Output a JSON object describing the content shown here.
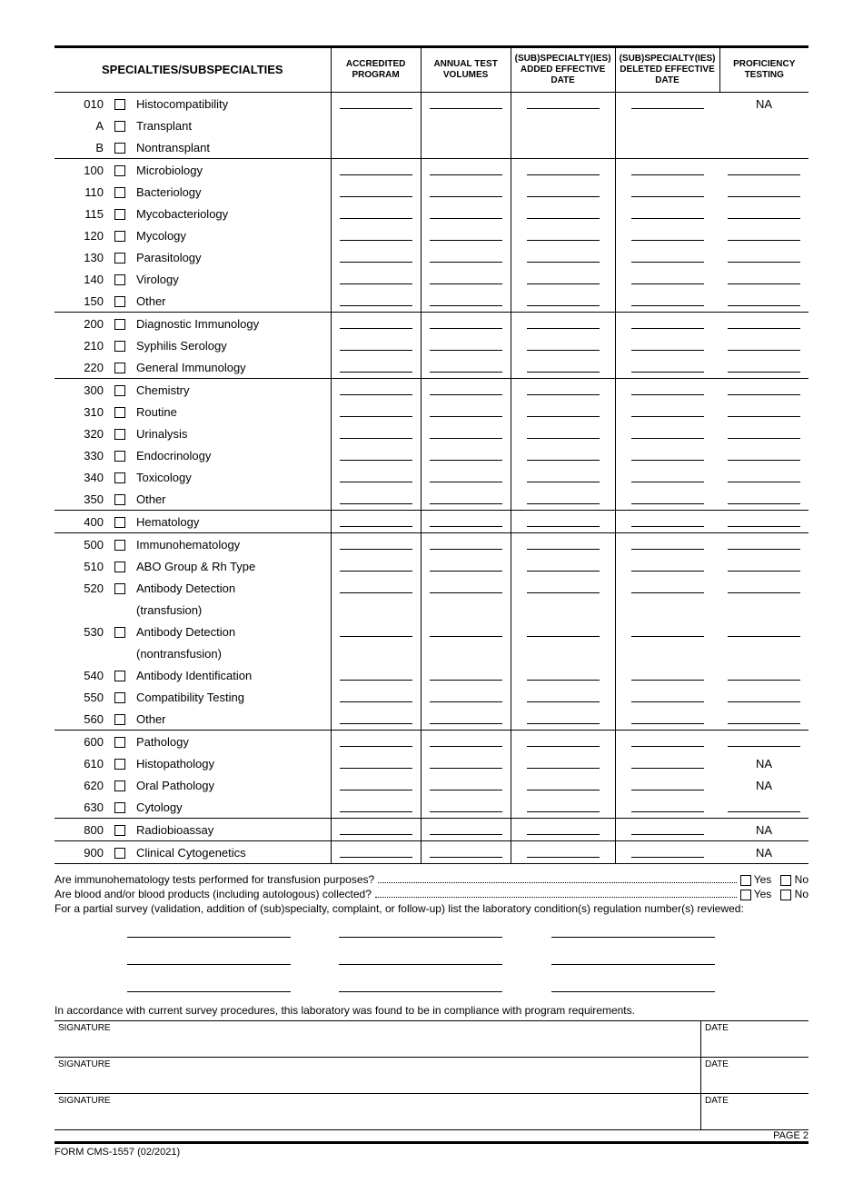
{
  "headers": {
    "col0": "SPECIALTIES/SUBSPECIALTIES",
    "col1": "ACCREDITED PROGRAM",
    "col2": "ANNUAL TEST VOLUMES",
    "col3": "(SUB)SPECIALTY(IES) ADDED EFFECTIVE DATE",
    "col4": "(SUB)SPECIALTY(IES) DELETED EFFECTIVE DATE",
    "col5": "PROFICIENCY TESTING"
  },
  "na": "NA",
  "rows": [
    {
      "code": "010",
      "label": "Histocompatibility",
      "sub": false,
      "b1": true,
      "b2": true,
      "b3": true,
      "b4": true,
      "prof": "NA",
      "sep": false
    },
    {
      "code": "A",
      "label": "Transplant",
      "sub": true,
      "b1": false,
      "b2": false,
      "b3": false,
      "b4": false,
      "prof": "",
      "sep": false
    },
    {
      "code": "B",
      "label": "Nontransplant",
      "sub": true,
      "b1": false,
      "b2": false,
      "b3": false,
      "b4": false,
      "prof": "",
      "sep": true
    },
    {
      "code": "100",
      "label": "Microbiology",
      "sub": false,
      "b1": true,
      "b2": true,
      "b3": true,
      "b4": true,
      "prof": "_",
      "sep": false
    },
    {
      "code": "110",
      "label": "Bacteriology",
      "sub": true,
      "b1": true,
      "b2": true,
      "b3": true,
      "b4": true,
      "prof": "_",
      "sep": false
    },
    {
      "code": "115",
      "label": "Mycobacteriology",
      "sub": true,
      "b1": true,
      "b2": true,
      "b3": true,
      "b4": true,
      "prof": "_",
      "sep": false
    },
    {
      "code": "120",
      "label": "Mycology",
      "sub": true,
      "b1": true,
      "b2": true,
      "b3": true,
      "b4": true,
      "prof": "_",
      "sep": false
    },
    {
      "code": "130",
      "label": "Parasitology",
      "sub": true,
      "b1": true,
      "b2": true,
      "b3": true,
      "b4": true,
      "prof": "_",
      "sep": false
    },
    {
      "code": "140",
      "label": "Virology",
      "sub": true,
      "b1": true,
      "b2": true,
      "b3": true,
      "b4": true,
      "prof": "_",
      "sep": false
    },
    {
      "code": "150",
      "label": "Other",
      "sub": true,
      "b1": true,
      "b2": true,
      "b3": true,
      "b4": true,
      "prof": "_",
      "sep": true
    },
    {
      "code": "200",
      "label": "Diagnostic Immunology",
      "sub": false,
      "b1": true,
      "b2": true,
      "b3": true,
      "b4": true,
      "prof": "_",
      "sep": false
    },
    {
      "code": "210",
      "label": "Syphilis Serology",
      "sub": true,
      "b1": true,
      "b2": true,
      "b3": true,
      "b4": true,
      "prof": "_",
      "sep": false
    },
    {
      "code": "220",
      "label": "General Immunology",
      "sub": true,
      "b1": true,
      "b2": true,
      "b3": true,
      "b4": true,
      "prof": "_",
      "sep": true
    },
    {
      "code": "300",
      "label": "Chemistry",
      "sub": false,
      "b1": true,
      "b2": true,
      "b3": true,
      "b4": true,
      "prof": "_",
      "sep": false
    },
    {
      "code": "310",
      "label": "Routine",
      "sub": true,
      "b1": true,
      "b2": true,
      "b3": true,
      "b4": true,
      "prof": "_",
      "sep": false
    },
    {
      "code": "320",
      "label": "Urinalysis",
      "sub": true,
      "b1": true,
      "b2": true,
      "b3": true,
      "b4": true,
      "prof": "_",
      "sep": false
    },
    {
      "code": "330",
      "label": "Endocrinology",
      "sub": true,
      "b1": true,
      "b2": true,
      "b3": true,
      "b4": true,
      "prof": "_",
      "sep": false
    },
    {
      "code": "340",
      "label": "Toxicology",
      "sub": true,
      "b1": true,
      "b2": true,
      "b3": true,
      "b4": true,
      "prof": "_",
      "sep": false
    },
    {
      "code": "350",
      "label": "Other",
      "sub": true,
      "b1": true,
      "b2": true,
      "b3": true,
      "b4": true,
      "prof": "_",
      "sep": true
    },
    {
      "code": "400",
      "label": "Hematology",
      "sub": false,
      "b1": true,
      "b2": true,
      "b3": true,
      "b4": true,
      "prof": "_",
      "sep": true
    },
    {
      "code": "500",
      "label": "Immunohematology",
      "sub": false,
      "b1": true,
      "b2": true,
      "b3": true,
      "b4": true,
      "prof": "_",
      "sep": false
    },
    {
      "code": "510",
      "label": "ABO Group & Rh Type",
      "sub": true,
      "b1": true,
      "b2": true,
      "b3": true,
      "b4": true,
      "prof": "_",
      "sep": false
    },
    {
      "code": "520",
      "label": "Antibody Detection",
      "note": "(transfusion)",
      "sub": true,
      "b1": true,
      "b2": true,
      "b3": true,
      "b4": true,
      "prof": "_",
      "sep": false
    },
    {
      "code": "530",
      "label": "Antibody Detection",
      "note": "(nontransfusion)",
      "sub": true,
      "b1": true,
      "b2": true,
      "b3": true,
      "b4": true,
      "prof": "_",
      "sep": false
    },
    {
      "code": "540",
      "label": "Antibody Identification",
      "sub": true,
      "b1": true,
      "b2": true,
      "b3": true,
      "b4": true,
      "prof": "_",
      "sep": false
    },
    {
      "code": "550",
      "label": "Compatibility Testing",
      "sub": true,
      "b1": true,
      "b2": true,
      "b3": true,
      "b4": true,
      "prof": "_",
      "sep": false
    },
    {
      "code": "560",
      "label": "Other",
      "sub": true,
      "b1": true,
      "b2": true,
      "b3": true,
      "b4": true,
      "prof": "_",
      "sep": true
    },
    {
      "code": "600",
      "label": "Pathology",
      "sub": false,
      "b1": true,
      "b2": true,
      "b3": true,
      "b4": true,
      "prof": "_",
      "sep": false
    },
    {
      "code": "610",
      "label": "Histopathology",
      "sub": true,
      "b1": true,
      "b2": true,
      "b3": true,
      "b4": true,
      "prof": "NA",
      "sep": false
    },
    {
      "code": "620",
      "label": "Oral Pathology",
      "sub": true,
      "b1": true,
      "b2": true,
      "b3": true,
      "b4": true,
      "prof": "NA",
      "sep": false
    },
    {
      "code": "630",
      "label": "Cytology",
      "sub": true,
      "b1": true,
      "b2": true,
      "b3": true,
      "b4": true,
      "prof": "_",
      "sep": true
    },
    {
      "code": "800",
      "label": "Radiobioassay",
      "sub": false,
      "b1": true,
      "b2": true,
      "b3": true,
      "b4": true,
      "prof": "NA",
      "sep": true
    },
    {
      "code": "900",
      "label": "Clinical Cytogenetics",
      "sub": false,
      "b1": true,
      "b2": true,
      "b3": true,
      "b4": true,
      "prof": "NA",
      "sep": true
    }
  ],
  "q1": "Are immunohematology tests performed for transfusion purposes?",
  "q2": "Are blood and/or blood products (including autologous) collected?",
  "q3": "For a partial survey (validation, addition of (sub)specialty, complaint, or follow-up) list the laboratory condition(s) regulation number(s) reviewed:",
  "yes": "Yes",
  "no": "No",
  "compliance": "In accordance with current survey procedures, this laboratory was found to be in compliance with program requirements.",
  "sig": "SIGNATURE",
  "date": "DATE",
  "formnum": "FORM CMS-1557 (02/2021)",
  "page": "PAGE 2"
}
